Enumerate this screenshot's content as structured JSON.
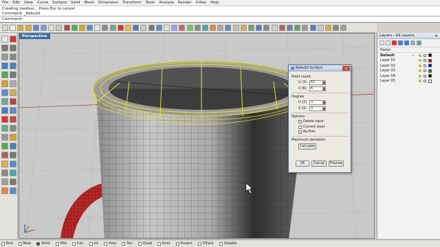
{
  "menu": [
    "File",
    "Edit",
    "View",
    "Curve",
    "Surface",
    "Solid",
    "Mesh",
    "Dimension",
    "Transform",
    "Tools",
    "Analyze",
    "Render",
    "V-Ray",
    "Help"
  ],
  "command_history": [
    "Creating meshes... Press Esc to cancel",
    "Command: _Rebuild"
  ],
  "command_prompt": "Command:",
  "viewport": {
    "title": "Perspective"
  },
  "rebuild_dialog": {
    "title": "Rebuild Surface",
    "close": "x",
    "point_count_label": "Point count",
    "u_points_label": "U (3)",
    "u_points_value": "62",
    "v_points_label": "V (6)",
    "v_points_value": "6",
    "degree_label": "Degree",
    "u_degree_label": "U (3)",
    "u_degree_value": "3",
    "v_degree_label": "V (3)",
    "v_degree_value": "3",
    "options_label": "Options",
    "delete_input_label": "Delete input",
    "current_layer_label": "Current layer",
    "retrim_label": "Re-Trim",
    "max_deviation_label": "Maximum deviation",
    "calculate_label": "Calculate",
    "ok_label": "OK",
    "cancel_label": "Cancel",
    "preview_label": "Preview"
  },
  "layers_panel": {
    "title": "Layers - All Layers",
    "close": "×",
    "column_name": "Name",
    "layers": [
      {
        "name": "Default",
        "current": true,
        "color": "#000000"
      },
      {
        "name": "Layer 01",
        "current": false,
        "color": "#ff0000"
      },
      {
        "name": "Layer 02",
        "current": false,
        "color": "#0000ff"
      },
      {
        "name": "Layer 03",
        "current": false,
        "color": "#00a000"
      },
      {
        "name": "Layer 04",
        "current": false,
        "color": "#000000"
      },
      {
        "name": "Layer 05",
        "current": false,
        "color": "#ffffff"
      }
    ]
  },
  "status_snaps": [
    {
      "label": "End",
      "on": false
    },
    {
      "label": "Near",
      "on": false
    },
    {
      "label": "Point",
      "on": true
    },
    {
      "label": "Mid",
      "on": false
    },
    {
      "label": "Cen",
      "on": false
    },
    {
      "label": "Int",
      "on": false
    },
    {
      "label": "Perp",
      "on": false
    },
    {
      "label": "Tan",
      "on": false
    },
    {
      "label": "Quad",
      "on": false
    },
    {
      "label": "Knot",
      "on": false
    },
    {
      "label": "Project",
      "on": false
    },
    {
      "label": "STrack",
      "on": false
    },
    {
      "label": "Disable",
      "on": false
    }
  ],
  "colors": {
    "selection_highlight": "#e8e230",
    "handle_red": "#c0282a",
    "viewport_bg": "#c9c9c9",
    "viewport_title_bg": "#3a6ea5"
  }
}
